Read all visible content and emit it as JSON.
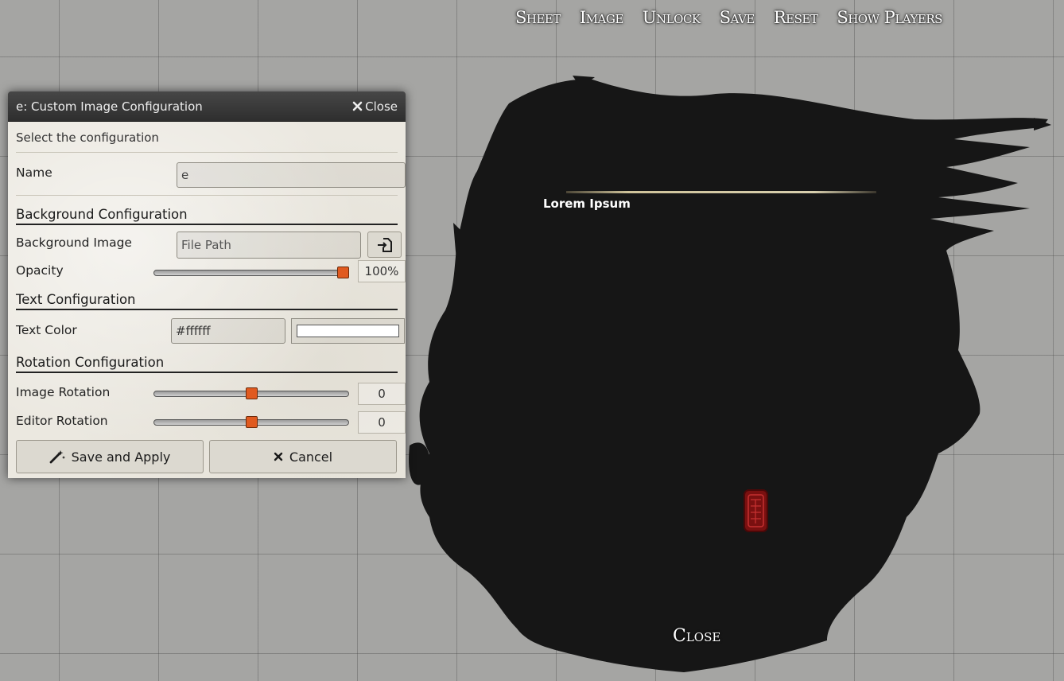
{
  "header": {
    "buttons": [
      "Sheet",
      "Image",
      "Unlock",
      "Save",
      "Reset",
      "Show Players"
    ]
  },
  "sheet": {
    "lorem": "Lorem Ipsum",
    "close_label": "Close"
  },
  "dialog": {
    "title": "e: Custom Image Configuration",
    "close_label": "Close",
    "hint": "Select the configuration",
    "name_label": "Name",
    "name_value": "e",
    "background_section": "Background Configuration",
    "background_image_label": "Background Image",
    "background_image_placeholder": "File Path",
    "opacity_label": "Opacity",
    "opacity_value": "100%",
    "opacity_fraction": 1.0,
    "text_section": "Text Configuration",
    "text_color_label": "Text Color",
    "text_color_value": "#ffffff",
    "rotation_section": "Rotation Configuration",
    "image_rotation_label": "Image Rotation",
    "image_rotation_value": "0",
    "editor_rotation_label": "Editor Rotation",
    "editor_rotation_value": "0",
    "save_label": "Save and Apply",
    "cancel_label": "Cancel"
  },
  "colors": {
    "accent": "#e05a20",
    "header_bg": "#3a3a3a",
    "dialog_bg": "#ebe8e0",
    "ink": "#161616"
  },
  "icons": [
    "close-icon",
    "file-picker-icon",
    "magic-wand-icon",
    "cancel-icon"
  ]
}
